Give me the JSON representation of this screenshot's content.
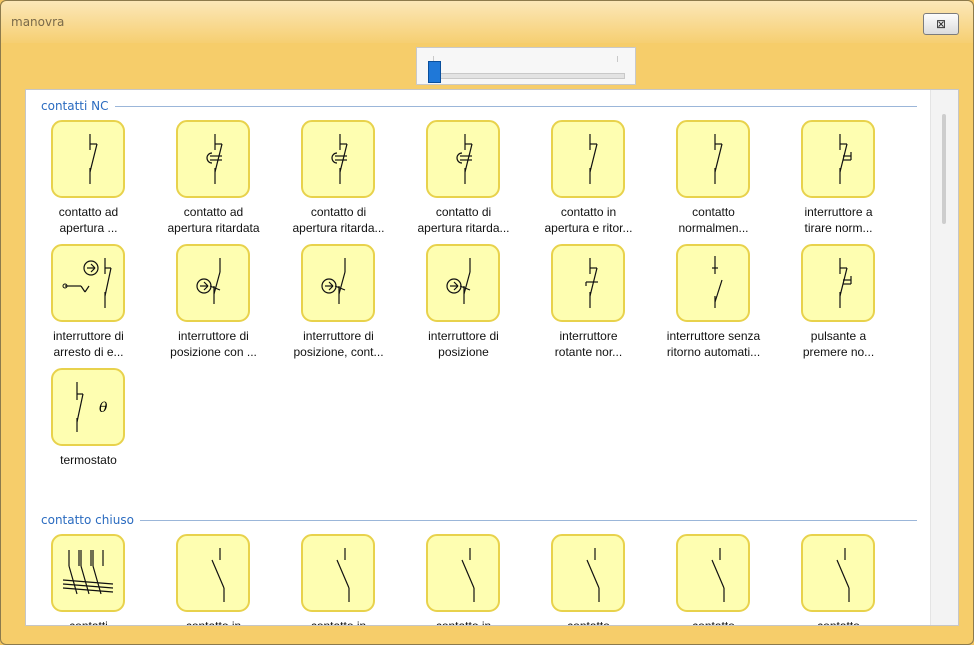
{
  "window": {
    "title": "manovra",
    "close_label": "⊠"
  },
  "zoom": {
    "level": 0
  },
  "sections": [
    {
      "title": "contatti NC",
      "items": [
        {
          "label1": "contatto ad",
          "label2": "apertura ...",
          "icon": "nc-contact-icon"
        },
        {
          "label1": "contatto ad",
          "label2": "apertura ritardata",
          "icon": "delayed-opening-contact-icon"
        },
        {
          "label1": "contatto di",
          "label2": "apertura ritarda...",
          "icon": "delayed-opening-contact-icon"
        },
        {
          "label1": "contatto di",
          "label2": "apertura ritarda...",
          "icon": "delayed-opening-contact-icon"
        },
        {
          "label1": "contatto in",
          "label2": "apertura e ritor...",
          "icon": "return-opening-contact-icon"
        },
        {
          "label1": "contatto",
          "label2": "normalmen...",
          "icon": "nc-contact-icon"
        },
        {
          "label1": "interruttore a",
          "label2": "tirare norm...",
          "icon": "pull-switch-icon"
        },
        {
          "label1": "interruttore di",
          "label2": "arresto di e...",
          "icon": "emergency-stop-switch-icon"
        },
        {
          "label1": "interruttore di",
          "label2": "posizione con ...",
          "icon": "position-switch-icon"
        },
        {
          "label1": "interruttore di",
          "label2": "posizione, cont...",
          "icon": "position-switch-icon"
        },
        {
          "label1": "interruttore di",
          "label2": "posizione",
          "icon": "position-switch-icon"
        },
        {
          "label1": "interruttore",
          "label2": "rotante nor...",
          "icon": "rotary-switch-icon"
        },
        {
          "label1": "interruttore senza",
          "label2": "ritorno automati...",
          "icon": "non-return-switch-icon"
        },
        {
          "label1": "pulsante a",
          "label2": "premere no...",
          "icon": "push-button-icon"
        },
        {
          "label1": "termostato",
          "label2": "",
          "icon": "thermostat-icon"
        }
      ]
    },
    {
      "title": "contatto chiuso",
      "items": [
        {
          "label1": "contatti",
          "label2": "",
          "icon": "multi-contact-icon"
        },
        {
          "label1": "contatto in",
          "label2": "",
          "icon": "closed-contact-icon"
        },
        {
          "label1": "contatto in",
          "label2": "",
          "icon": "closed-contact-icon"
        },
        {
          "label1": "contatto in",
          "label2": "",
          "icon": "closed-contact-icon"
        },
        {
          "label1": "contatto",
          "label2": "",
          "icon": "closed-contact-icon"
        },
        {
          "label1": "contatto",
          "label2": "",
          "icon": "closed-contact-icon"
        },
        {
          "label1": "contatto",
          "label2": "",
          "icon": "closed-contact-icon"
        }
      ]
    }
  ],
  "colors": {
    "window_bg": "#f6cd6a",
    "tile_fill": "#fefeb1",
    "tile_border": "#e8d24c",
    "section_title": "#2a6bc0"
  }
}
